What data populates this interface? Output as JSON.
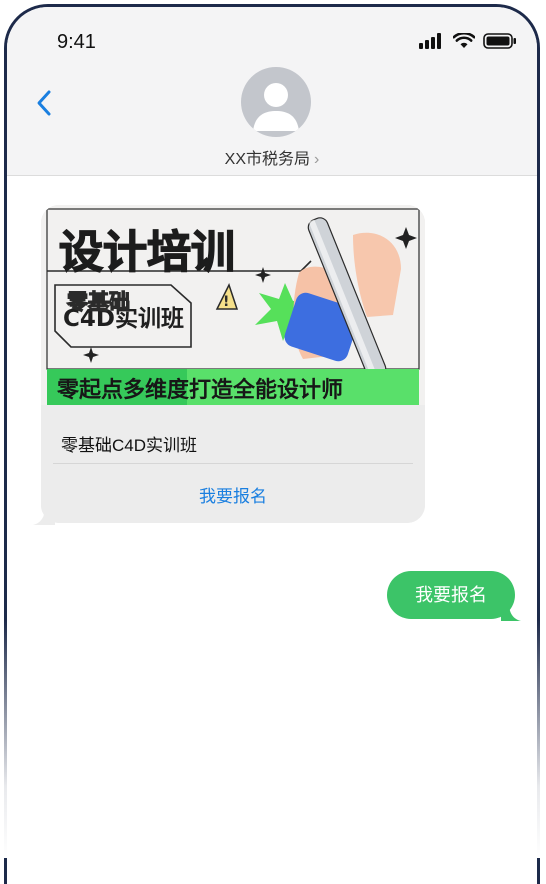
{
  "status_bar": {
    "time": "9:41"
  },
  "header": {
    "contact_name": "XX市税务局",
    "chevron": "›"
  },
  "card": {
    "banner": {
      "headline": "设计培训",
      "sub_badge": "零基础",
      "course_code": "C4D实训班",
      "slogan": "零起点多维度打造全能设计师"
    },
    "title": "零基础C4D实训班",
    "action_label": "我要报名"
  },
  "reply": {
    "text": "我要报名"
  },
  "colors": {
    "accent_blue": "#1a7fe0",
    "reply_green": "#3cc468",
    "banner_green": "#59e06a"
  }
}
